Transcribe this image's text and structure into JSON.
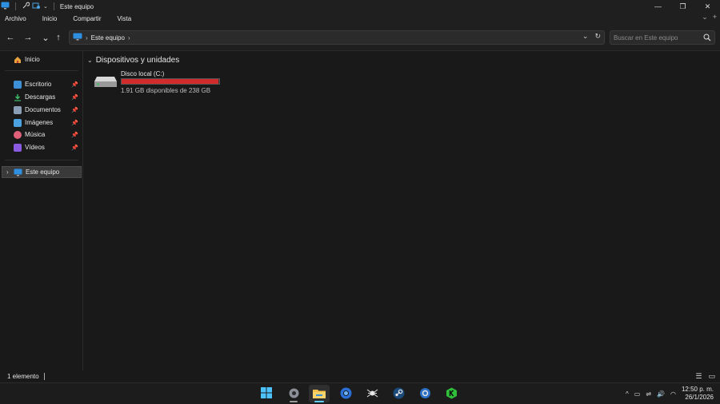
{
  "window": {
    "title": "Este equipo",
    "controls": {
      "minimize": "—",
      "maximize": "❐",
      "close": "✕"
    }
  },
  "menu": {
    "items": [
      "Archivo",
      "Inicio",
      "Compartir",
      "Vista"
    ]
  },
  "address": {
    "path_label": "Este equipo",
    "search_placeholder": "Buscar en Este equipo"
  },
  "sidebar": {
    "home": {
      "label": "Inicio",
      "icon": "home-icon"
    },
    "quick_access": [
      {
        "label": "Escritorio",
        "icon": "desktop-folder-icon",
        "color": "#3d8fd8",
        "pinned": true
      },
      {
        "label": "Descargas",
        "icon": "download-icon",
        "color": "#3fbf6a",
        "pinned": true
      },
      {
        "label": "Documentos",
        "icon": "documents-icon",
        "color": "#8a9fb5",
        "pinned": true
      },
      {
        "label": "Imágenes",
        "icon": "pictures-icon",
        "color": "#4aa3e0",
        "pinned": true
      },
      {
        "label": "Música",
        "icon": "music-icon",
        "color": "#e0607a",
        "pinned": true
      },
      {
        "label": "Vídeos",
        "icon": "videos-icon",
        "color": "#8a5ae0",
        "pinned": true
      }
    ],
    "this_pc": {
      "label": "Este equipo",
      "icon": "computer-icon",
      "selected": true
    }
  },
  "main": {
    "group_title": "Dispositivos y unidades",
    "drives": [
      {
        "name": "Disco local (C:)",
        "free_text": "1.91 GB disponibles de 238 GB",
        "used_fraction": 0.992,
        "bar_color": "#d22b2b"
      }
    ]
  },
  "status": {
    "item_count": "1 elemento"
  },
  "taskbar": {
    "apps": [
      {
        "name": "start",
        "icon": "windows-start-icon"
      },
      {
        "name": "settings",
        "icon": "settings-gear-icon",
        "running": true
      },
      {
        "name": "file-explorer",
        "icon": "folder-icon",
        "running": true,
        "active": true
      },
      {
        "name": "browser",
        "icon": "browser-icon"
      },
      {
        "name": "app-spider",
        "icon": "spider-icon"
      },
      {
        "name": "steam",
        "icon": "steam-icon"
      },
      {
        "name": "app-gear",
        "icon": "cog-icon"
      },
      {
        "name": "app-k",
        "icon": "k-hex-icon"
      }
    ],
    "time": "12:50 p. m.",
    "date": "26/1/2026"
  }
}
